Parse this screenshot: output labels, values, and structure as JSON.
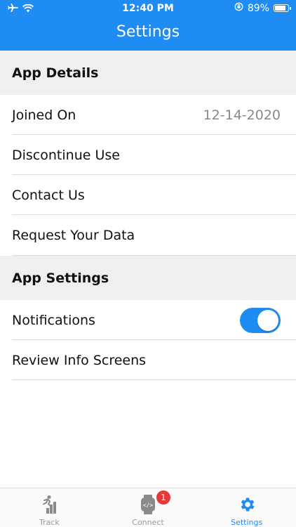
{
  "status_bar": {
    "time": "12:40 PM",
    "battery_percent": "89%",
    "battery_level": 0.89
  },
  "header": {
    "title": "Settings"
  },
  "sections": {
    "app_details": {
      "title": "App Details",
      "joined_on": {
        "label": "Joined On",
        "value": "12-14-2020"
      },
      "discontinue": {
        "label": "Discontinue Use"
      },
      "contact": {
        "label": "Contact Us"
      },
      "request_data": {
        "label": "Request Your Data"
      }
    },
    "app_settings": {
      "title": "App Settings",
      "notifications": {
        "label": "Notifications",
        "enabled": true
      },
      "review_info": {
        "label": "Review Info Screens"
      }
    }
  },
  "tab_bar": {
    "track": {
      "label": "Track",
      "icon": "track-icon"
    },
    "connect": {
      "label": "Connect",
      "icon": "watch-code-icon",
      "badge": "1"
    },
    "settings": {
      "label": "Settings",
      "icon": "gear-icon",
      "active": true
    }
  },
  "colors": {
    "accent": "#1e8cf2",
    "badge": "#e53935",
    "section_bg": "#efeff0"
  }
}
